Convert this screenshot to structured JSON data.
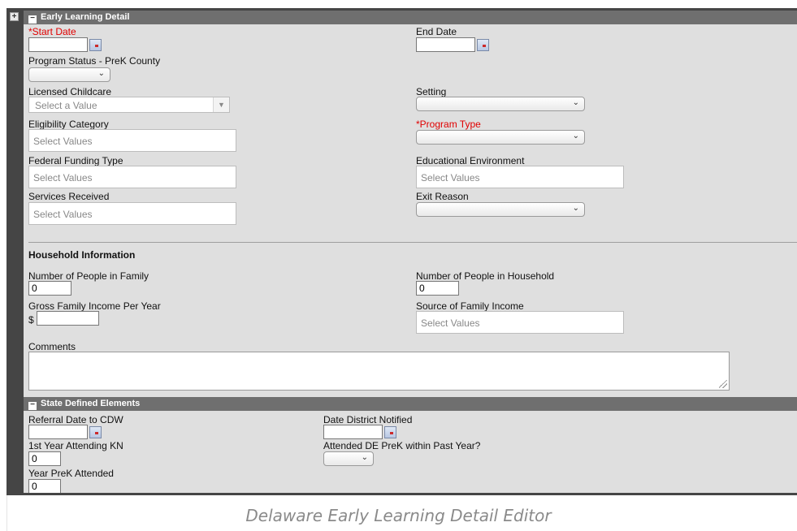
{
  "gutter": {
    "toggle": "+"
  },
  "early_learning": {
    "header": "Early Learning Detail",
    "collapse": "−",
    "start_date_label": "*Start Date",
    "end_date_label": "End Date",
    "program_status_label": "Program Status - PreK County",
    "licensed_childcare_label": "Licensed Childcare",
    "licensed_childcare_placeholder": "Select a Value",
    "setting_label": "Setting",
    "eligibility_label": "Eligibility Category",
    "eligibility_placeholder": "Select Values",
    "program_type_label": "*Program Type",
    "federal_funding_label": "Federal Funding Type",
    "federal_funding_placeholder": "Select Values",
    "educational_env_label": "Educational Environment",
    "educational_env_placeholder": "Select Values",
    "services_label": "Services Received",
    "services_placeholder": "Select Values",
    "exit_reason_label": "Exit Reason"
  },
  "household": {
    "heading": "Household Information",
    "people_family_label": "Number of People in Family",
    "people_family_value": "0",
    "people_household_label": "Number of People in Household",
    "people_household_value": "0",
    "income_label": "Gross Family Income Per Year",
    "currency_symbol": "$",
    "income_source_label": "Source of Family Income",
    "income_source_placeholder": "Select Values",
    "comments_label": "Comments"
  },
  "state_defined": {
    "header": "State Defined Elements",
    "collapse": "−",
    "referral_label": "Referral Date to CDW",
    "district_notified_label": "Date District Notified",
    "first_year_kn_label": "1st Year Attending KN",
    "first_year_kn_value": "0",
    "attended_prek_label": "Attended DE PreK within Past Year?",
    "year_prek_label": "Year PreK Attended",
    "year_prek_value": "0"
  },
  "caption": "Delaware Early Learning Detail Editor"
}
